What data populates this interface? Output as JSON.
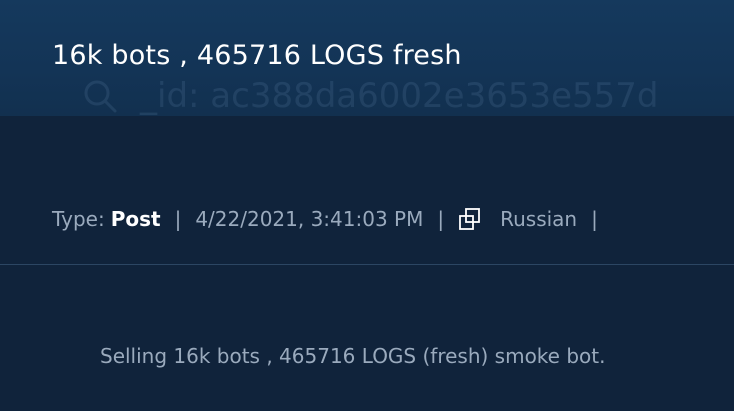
{
  "post": {
    "title": "16k bots , 465716 LOGS fresh",
    "background_id": "_id: ac388da6002e3653e557d",
    "type_label": "Type:",
    "type_value": "Post",
    "separator": "|",
    "timestamp": "4/22/2021, 3:41:03 PM",
    "language_icon": "translate-copy-icon",
    "language": "Russian",
    "content": "Selling 16k bots , 465716 LOGS (fresh) smoke bot."
  },
  "colors": {
    "background": "#10233b",
    "header": "#14365a",
    "text_primary": "#ffffff",
    "text_secondary": "#9aaabd",
    "divider": "#2c4663"
  }
}
